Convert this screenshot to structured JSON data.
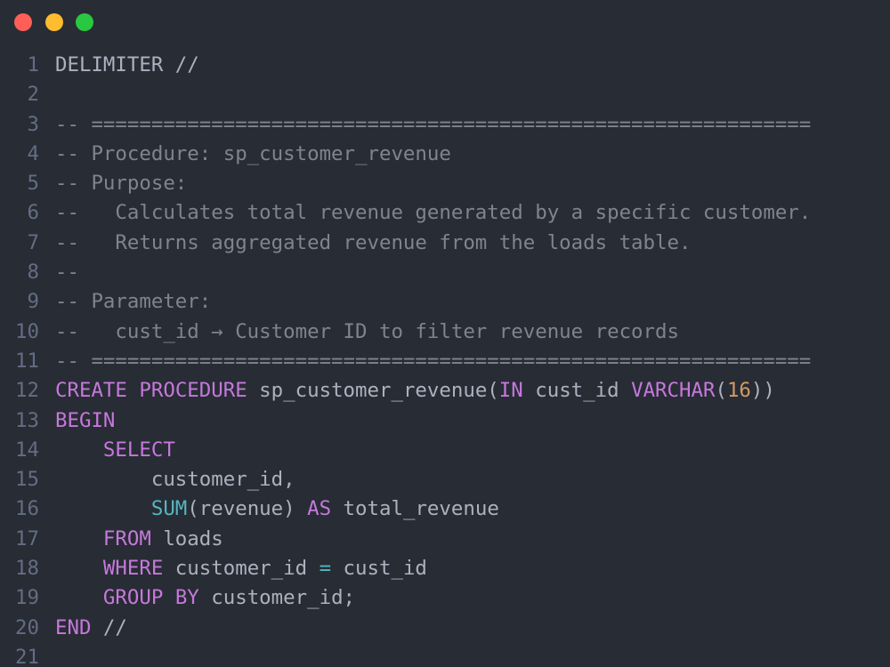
{
  "colors": {
    "background": "#282c34",
    "line_number": "#636d83",
    "text": "#abb2bf",
    "comment": "#7f848e",
    "keyword": "#c678dd",
    "function": "#56b6c2",
    "number": "#d19a66"
  },
  "window": {
    "controls": [
      "close",
      "minimize",
      "maximize"
    ]
  },
  "lines": [
    {
      "n": "1",
      "tokens": [
        {
          "t": "plain",
          "v": "DELIMITER //"
        }
      ]
    },
    {
      "n": "2",
      "tokens": []
    },
    {
      "n": "3",
      "tokens": [
        {
          "t": "comment",
          "v": "-- ============================================================"
        }
      ]
    },
    {
      "n": "4",
      "tokens": [
        {
          "t": "comment",
          "v": "-- Procedure: sp_customer_revenue"
        }
      ]
    },
    {
      "n": "5",
      "tokens": [
        {
          "t": "comment",
          "v": "-- Purpose:"
        }
      ]
    },
    {
      "n": "6",
      "tokens": [
        {
          "t": "comment",
          "v": "--   Calculates total revenue generated by a specific customer."
        }
      ]
    },
    {
      "n": "7",
      "tokens": [
        {
          "t": "comment",
          "v": "--   Returns aggregated revenue from the loads table."
        }
      ]
    },
    {
      "n": "8",
      "tokens": [
        {
          "t": "comment",
          "v": "--"
        }
      ]
    },
    {
      "n": "9",
      "tokens": [
        {
          "t": "comment",
          "v": "-- Parameter:"
        }
      ]
    },
    {
      "n": "10",
      "tokens": [
        {
          "t": "comment",
          "v": "--   cust_id → Customer ID to filter revenue records"
        }
      ]
    },
    {
      "n": "11",
      "tokens": [
        {
          "t": "comment",
          "v": "-- ============================================================"
        }
      ]
    },
    {
      "n": "12",
      "tokens": [
        {
          "t": "kw",
          "v": "CREATE"
        },
        {
          "t": "plain",
          "v": " "
        },
        {
          "t": "kw",
          "v": "PROCEDURE"
        },
        {
          "t": "plain",
          "v": " sp_customer_revenue("
        },
        {
          "t": "kw",
          "v": "IN"
        },
        {
          "t": "plain",
          "v": " cust_id "
        },
        {
          "t": "kw",
          "v": "VARCHAR"
        },
        {
          "t": "plain",
          "v": "("
        },
        {
          "t": "num",
          "v": "16"
        },
        {
          "t": "plain",
          "v": "))"
        }
      ]
    },
    {
      "n": "13",
      "tokens": [
        {
          "t": "kw",
          "v": "BEGIN"
        }
      ]
    },
    {
      "n": "14",
      "tokens": [
        {
          "t": "plain",
          "v": "    "
        },
        {
          "t": "kw",
          "v": "SELECT"
        }
      ]
    },
    {
      "n": "15",
      "tokens": [
        {
          "t": "plain",
          "v": "        customer_id,"
        }
      ]
    },
    {
      "n": "16",
      "tokens": [
        {
          "t": "plain",
          "v": "        "
        },
        {
          "t": "fn",
          "v": "SUM"
        },
        {
          "t": "plain",
          "v": "(revenue) "
        },
        {
          "t": "kw",
          "v": "AS"
        },
        {
          "t": "plain",
          "v": " total_revenue"
        }
      ]
    },
    {
      "n": "17",
      "tokens": [
        {
          "t": "plain",
          "v": "    "
        },
        {
          "t": "kw",
          "v": "FROM"
        },
        {
          "t": "plain",
          "v": " loads"
        }
      ]
    },
    {
      "n": "18",
      "tokens": [
        {
          "t": "plain",
          "v": "    "
        },
        {
          "t": "kw",
          "v": "WHERE"
        },
        {
          "t": "plain",
          "v": " customer_id "
        },
        {
          "t": "op",
          "v": "="
        },
        {
          "t": "plain",
          "v": " cust_id"
        }
      ]
    },
    {
      "n": "19",
      "tokens": [
        {
          "t": "plain",
          "v": "    "
        },
        {
          "t": "kw",
          "v": "GROUP"
        },
        {
          "t": "plain",
          "v": " "
        },
        {
          "t": "kw",
          "v": "BY"
        },
        {
          "t": "plain",
          "v": " customer_id;"
        }
      ]
    },
    {
      "n": "20",
      "tokens": [
        {
          "t": "kw",
          "v": "END"
        },
        {
          "t": "plain",
          "v": " //"
        }
      ]
    },
    {
      "n": "21",
      "tokens": []
    }
  ]
}
